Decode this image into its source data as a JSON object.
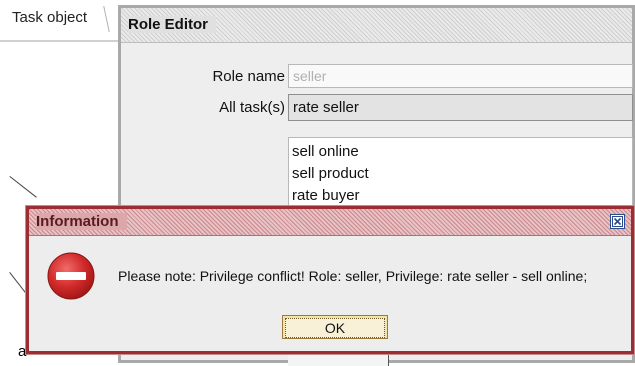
{
  "task_panel": {
    "tab_label": "Task object",
    "canvas_label": "a"
  },
  "role_editor": {
    "title": "Role Editor",
    "role_name_label": "Role name",
    "role_name_value": "seller",
    "all_tasks_label": "All task(s)",
    "all_tasks_selected": "rate seller",
    "task_list": [
      "sell online",
      "sell product",
      "rate buyer"
    ]
  },
  "info_dialog": {
    "title": "Information",
    "message": "Please note: Privilege conflict!  Role: seller, Privilege: rate seller - sell online;",
    "ok_label": "OK",
    "icon": "error-icon",
    "colors": {
      "border": "#9b2d33",
      "title_text": "#5a1b20",
      "error_red": "#d12a2a"
    }
  }
}
